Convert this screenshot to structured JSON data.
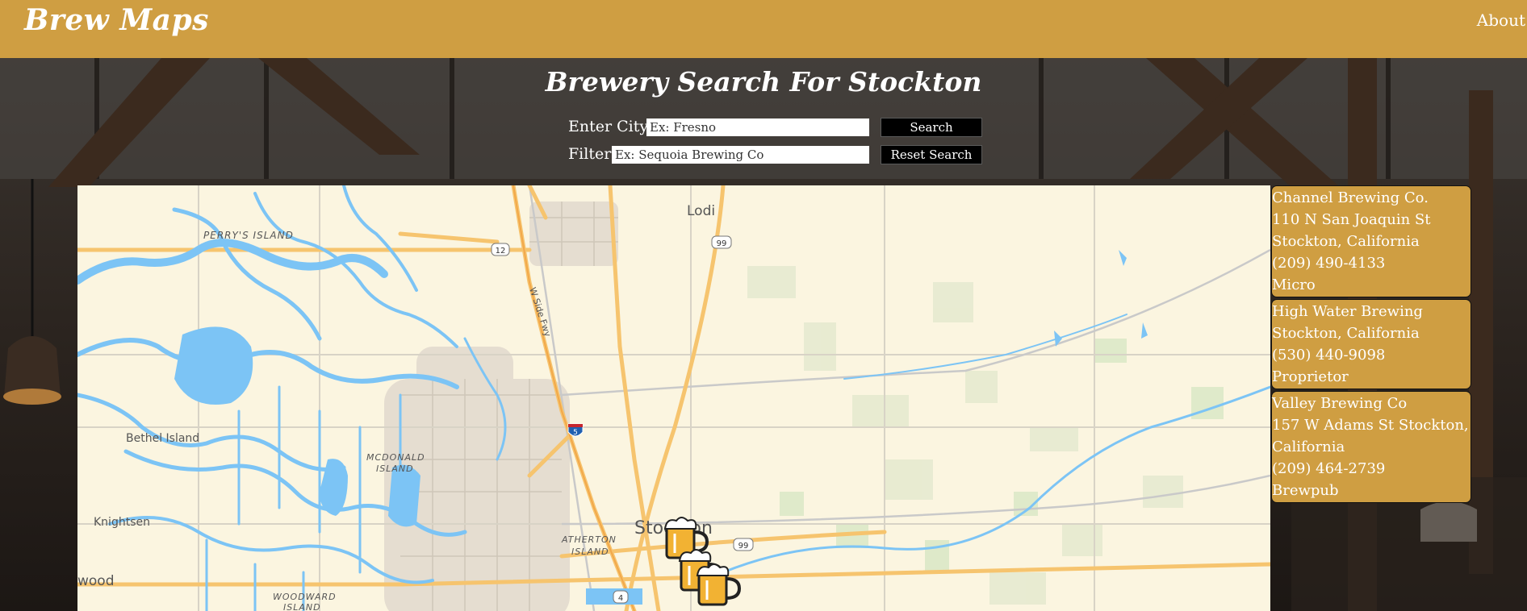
{
  "header": {
    "brand": "Brew Maps",
    "about_link": "About"
  },
  "search": {
    "title": "Brewery Search For Stockton",
    "city_label": "Enter City:",
    "city_placeholder": "Ex: Fresno",
    "filter_label": "Filter:",
    "filter_placeholder": "Ex: Sequoia Brewing Co",
    "search_button": "Search",
    "reset_button": "Reset Search"
  },
  "map": {
    "labels": {
      "lodi": "Lodi",
      "perrys_island": "PERRY'S ISLAND",
      "bethel_island": "Bethel Island",
      "mcdonald": "MCDONALD",
      "island": "ISLAND",
      "knightsen": "Knightsen",
      "atherton": "ATHERTON",
      "island2": "ISLAND",
      "stockton": "Stockton",
      "wood": "wood",
      "woodward": "WOODWARD",
      "island3": "ISLAND",
      "w_side_fwy": "W Side Fwy"
    },
    "shields": {
      "r12": "12",
      "r99a": "99",
      "i5": "5",
      "r99b": "99",
      "r4": "4"
    },
    "markers_icon": "beer-mug-icon"
  },
  "breweries": [
    {
      "name": "Channel Brewing Co.",
      "lines": [
        "110 N San Joaquin St",
        "Stockton, California"
      ],
      "phone": "(209) 490-4133",
      "type": "Micro"
    },
    {
      "name": "High Water Brewing",
      "lines": [
        "Stockton, California"
      ],
      "phone": "(530) 440-9098",
      "type": "Proprietor"
    },
    {
      "name": "Valley Brewing Co",
      "lines": [
        "157 W Adams St Stockton, California"
      ],
      "phone": "(209) 464-2739",
      "type": "Brewpub"
    }
  ],
  "colors": {
    "header": "#cf9e42",
    "card": "#cf9e42",
    "water": "#7cc4f5",
    "highway": "#f6c46e",
    "map_bg": "#fbf5e0"
  }
}
